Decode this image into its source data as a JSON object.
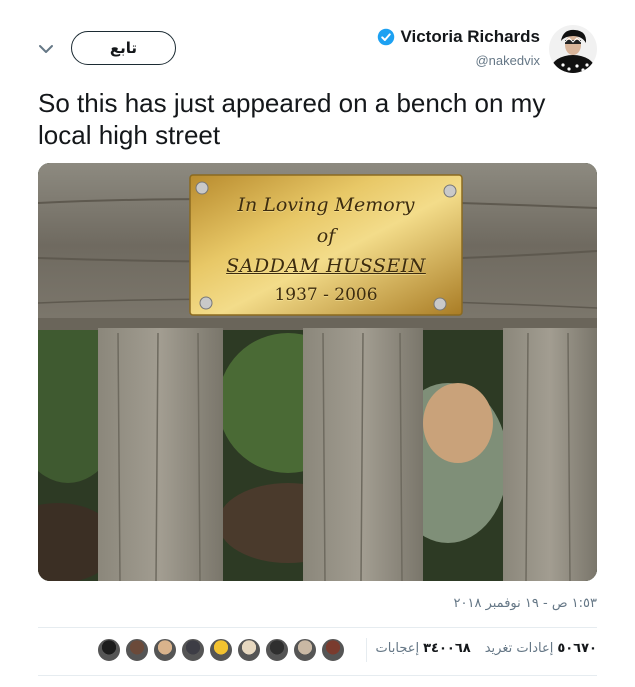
{
  "header": {
    "follow_label": "تابع",
    "display_name": "Victoria Richards",
    "handle": "@nakedvix",
    "verified": true,
    "icons": {
      "menu": "chevron-down-icon",
      "verified": "verified-badge-icon"
    }
  },
  "tweet": {
    "text": "So this has just appeared on a bench on my local high street"
  },
  "photo": {
    "plaque_line1": "In Loving Memory",
    "plaque_line2": "of",
    "plaque_line3": "SADDAM HUSSEIN",
    "plaque_line4": "1937 - 2006"
  },
  "meta": {
    "timestamp": "١:٥٣ ص - ١٩ نوفمبر ٢٠١٨"
  },
  "stats": {
    "retweets_count": "٥٠٦٧٠",
    "retweets_label": "إعادات تغريد",
    "likes_count": "٣٤٠٠٦٨",
    "likes_label": "إعجابات",
    "liker_avatar_colors": [
      "#7a3b2e",
      "#c9b8a4",
      "#2f2f2f",
      "#e7d8c0",
      "#f2c230",
      "#3d3d45",
      "#d9b38c",
      "#6b4a3a",
      "#1c1c1c"
    ]
  },
  "colors": {
    "accent": "#1da1f2",
    "text": "#14171a",
    "muted": "#657786",
    "divider": "#e6ecf0"
  }
}
